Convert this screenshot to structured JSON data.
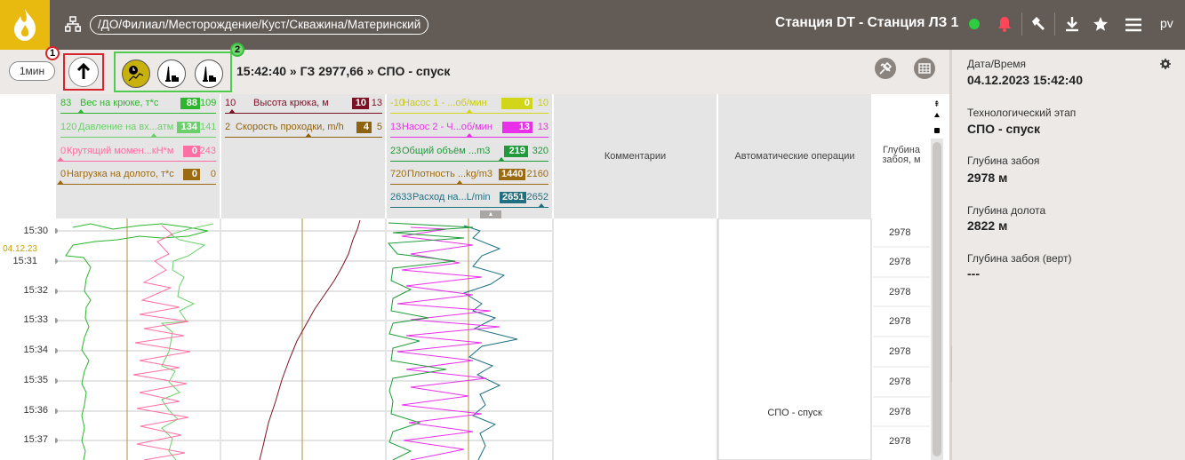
{
  "topbar": {
    "breadcrumb": "/ДО/Филиал/Месторождение/Куст/Скважина/Материнский",
    "station": "Станция DT - Станция ЛЗ 1",
    "user": "pv",
    "icons": [
      "flame-logo-icon",
      "hierarchy-icon",
      "status-dot-icon",
      "bell-icon",
      "hammer-icon",
      "download-icon",
      "star-icon",
      "menu-icon"
    ]
  },
  "toolbar": {
    "interval": "1мин",
    "badge1": "1",
    "badge2": "2",
    "status": "15:42:40 » ГЗ 2977,66 » СПО - спуск"
  },
  "panels": [
    {
      "tracks": [
        {
          "lo": "83",
          "name": "Вес на крюке, т*с",
          "value": "88",
          "hi": "109",
          "color": "#2db52d"
        },
        {
          "lo": "120",
          "name": "Давление на вх...атм",
          "value": "134",
          "hi": "141",
          "color": "#6bd06b"
        },
        {
          "lo": "0",
          "name": "Крутящий момен...кН*м",
          "value": "0",
          "hi": "243",
          "color": "#ff6fa3"
        },
        {
          "lo": "0",
          "name": "Нагрузка на долото, т*с",
          "value": "0",
          "hi": "0",
          "color": "#9c6a10"
        }
      ]
    },
    {
      "tracks": [
        {
          "lo": "10",
          "name": "Высота крюка, м",
          "value": "10",
          "hi": "13",
          "color": "#7a1226"
        },
        {
          "lo": "2",
          "name": "Скорость проходки, m/h",
          "value": "4",
          "hi": "5",
          "color": "#8d6310"
        }
      ]
    },
    {
      "tracks": [
        {
          "lo": "-10",
          "name": "Насос 1 - ...об/мин",
          "value": "0",
          "hi": "10",
          "color": "#d2d61a"
        },
        {
          "lo": "13",
          "name": "Насос 2 - Ч...об/мин",
          "value": "13",
          "hi": "13",
          "color": "#e830e8"
        },
        {
          "lo": "23",
          "name": "Общий объём ...m3",
          "value": "219",
          "hi": "320",
          "color": "#1f9b3a"
        },
        {
          "lo": "720",
          "name": "Плотность ...kg/m3",
          "value": "1440",
          "hi": "2160",
          "color": "#9c6a10"
        },
        {
          "lo": "2633",
          "name": "Расход на...L/min",
          "value": "2651",
          "hi": "2652",
          "color": "#1e6f80"
        }
      ]
    }
  ],
  "columns": {
    "comments": "Комментарии",
    "auto_ops": "Автоматические операции",
    "depth_header": "Глубина забоя, м"
  },
  "time": {
    "date": "04.12.23",
    "ticks": [
      "15:30",
      "15:31",
      "15:32",
      "15:33",
      "15:34",
      "15:35",
      "15:36",
      "15:37"
    ]
  },
  "depth_values": [
    "2978",
    "2978",
    "2978",
    "2978",
    "2978",
    "2978",
    "2978",
    "2978"
  ],
  "auto_op_label": "СПО - спуск",
  "right_panel": {
    "datetime_label": "Дата/Время",
    "datetime": "04.12.2023 15:42:40",
    "stage_label": "Технологический этап",
    "stage": "СПО - спуск",
    "bottom_label": "Глубина забоя",
    "bottom": "2978 м",
    "bit_label": "Глубина долота",
    "bit": "2822 м",
    "vert_label": "Глубина забоя (верт)",
    "vert": "---"
  }
}
